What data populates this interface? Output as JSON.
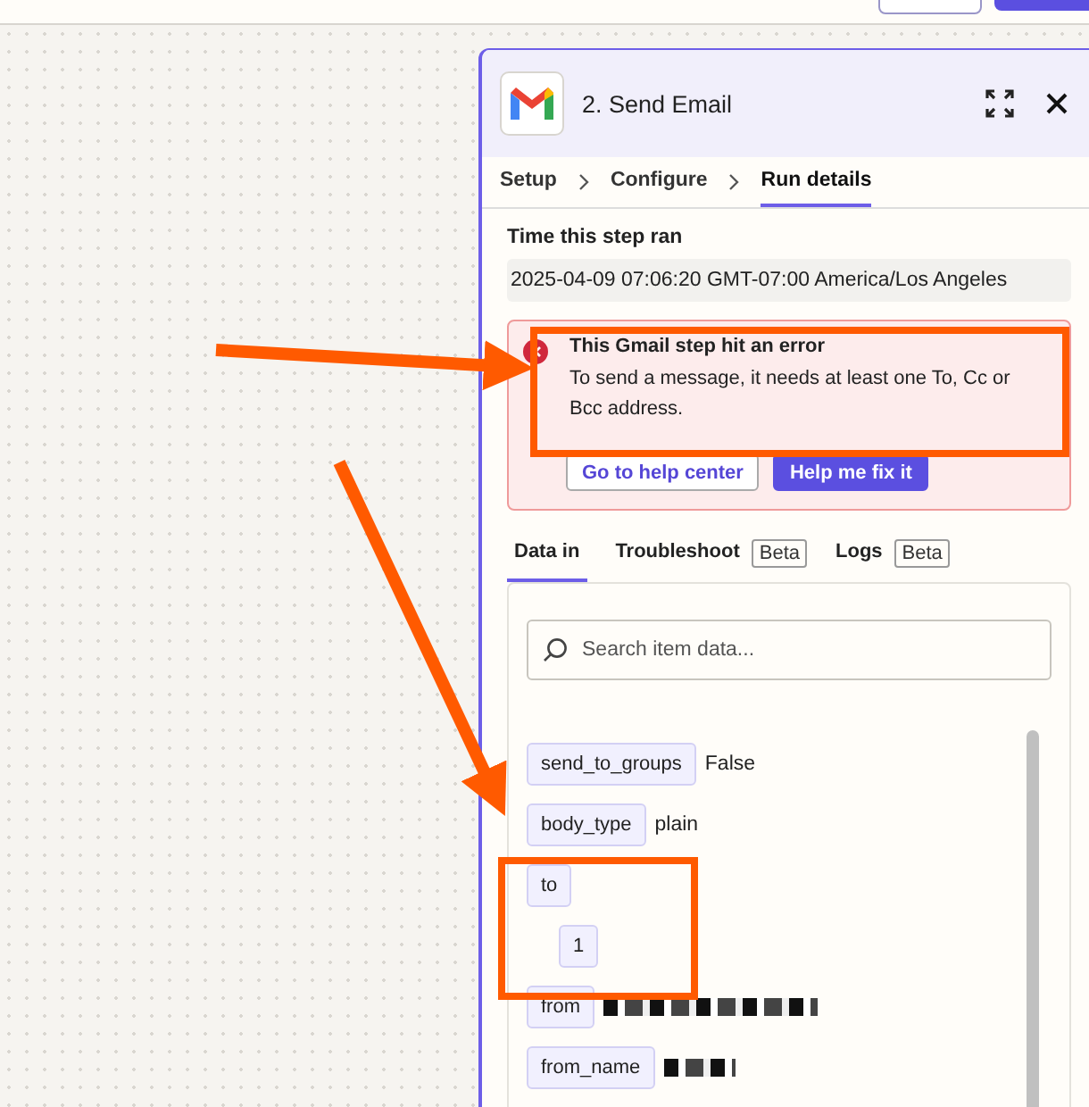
{
  "panel": {
    "title": "2. Send Email",
    "steps": [
      {
        "label": "Setup",
        "selected": false
      },
      {
        "label": "Configure",
        "selected": false
      },
      {
        "label": "Run details",
        "selected": true
      }
    ]
  },
  "run_time": {
    "label": "Time this step ran",
    "value": "2025-04-09 07:06:20 GMT-07:00 America/Los Angeles"
  },
  "error": {
    "title": "This Gmail step hit an error",
    "message": "To send a message, it needs at least one To, Cc or Bcc address.",
    "buttons": [
      {
        "label": "Go to help center",
        "kind": "outline"
      },
      {
        "label": "Help me fix it",
        "kind": "primary"
      }
    ]
  },
  "data_tabs": [
    {
      "label": "Data in",
      "selected": true
    },
    {
      "label": "Troubleshoot",
      "badge": "Beta",
      "selected": false
    },
    {
      "label": "Logs",
      "badge": "Beta",
      "selected": false
    }
  ],
  "search": {
    "placeholder": "Search item data..."
  },
  "items": [
    {
      "key": "send_to_groups",
      "kind": "value",
      "value": "False"
    },
    {
      "key": "body_type",
      "kind": "value",
      "value": "plain"
    },
    {
      "key": "to",
      "kind": "parent",
      "children": [
        {
          "key": "1"
        }
      ]
    },
    {
      "key": "from",
      "kind": "redacted"
    },
    {
      "key": "from_name",
      "kind": "redacted"
    }
  ]
}
